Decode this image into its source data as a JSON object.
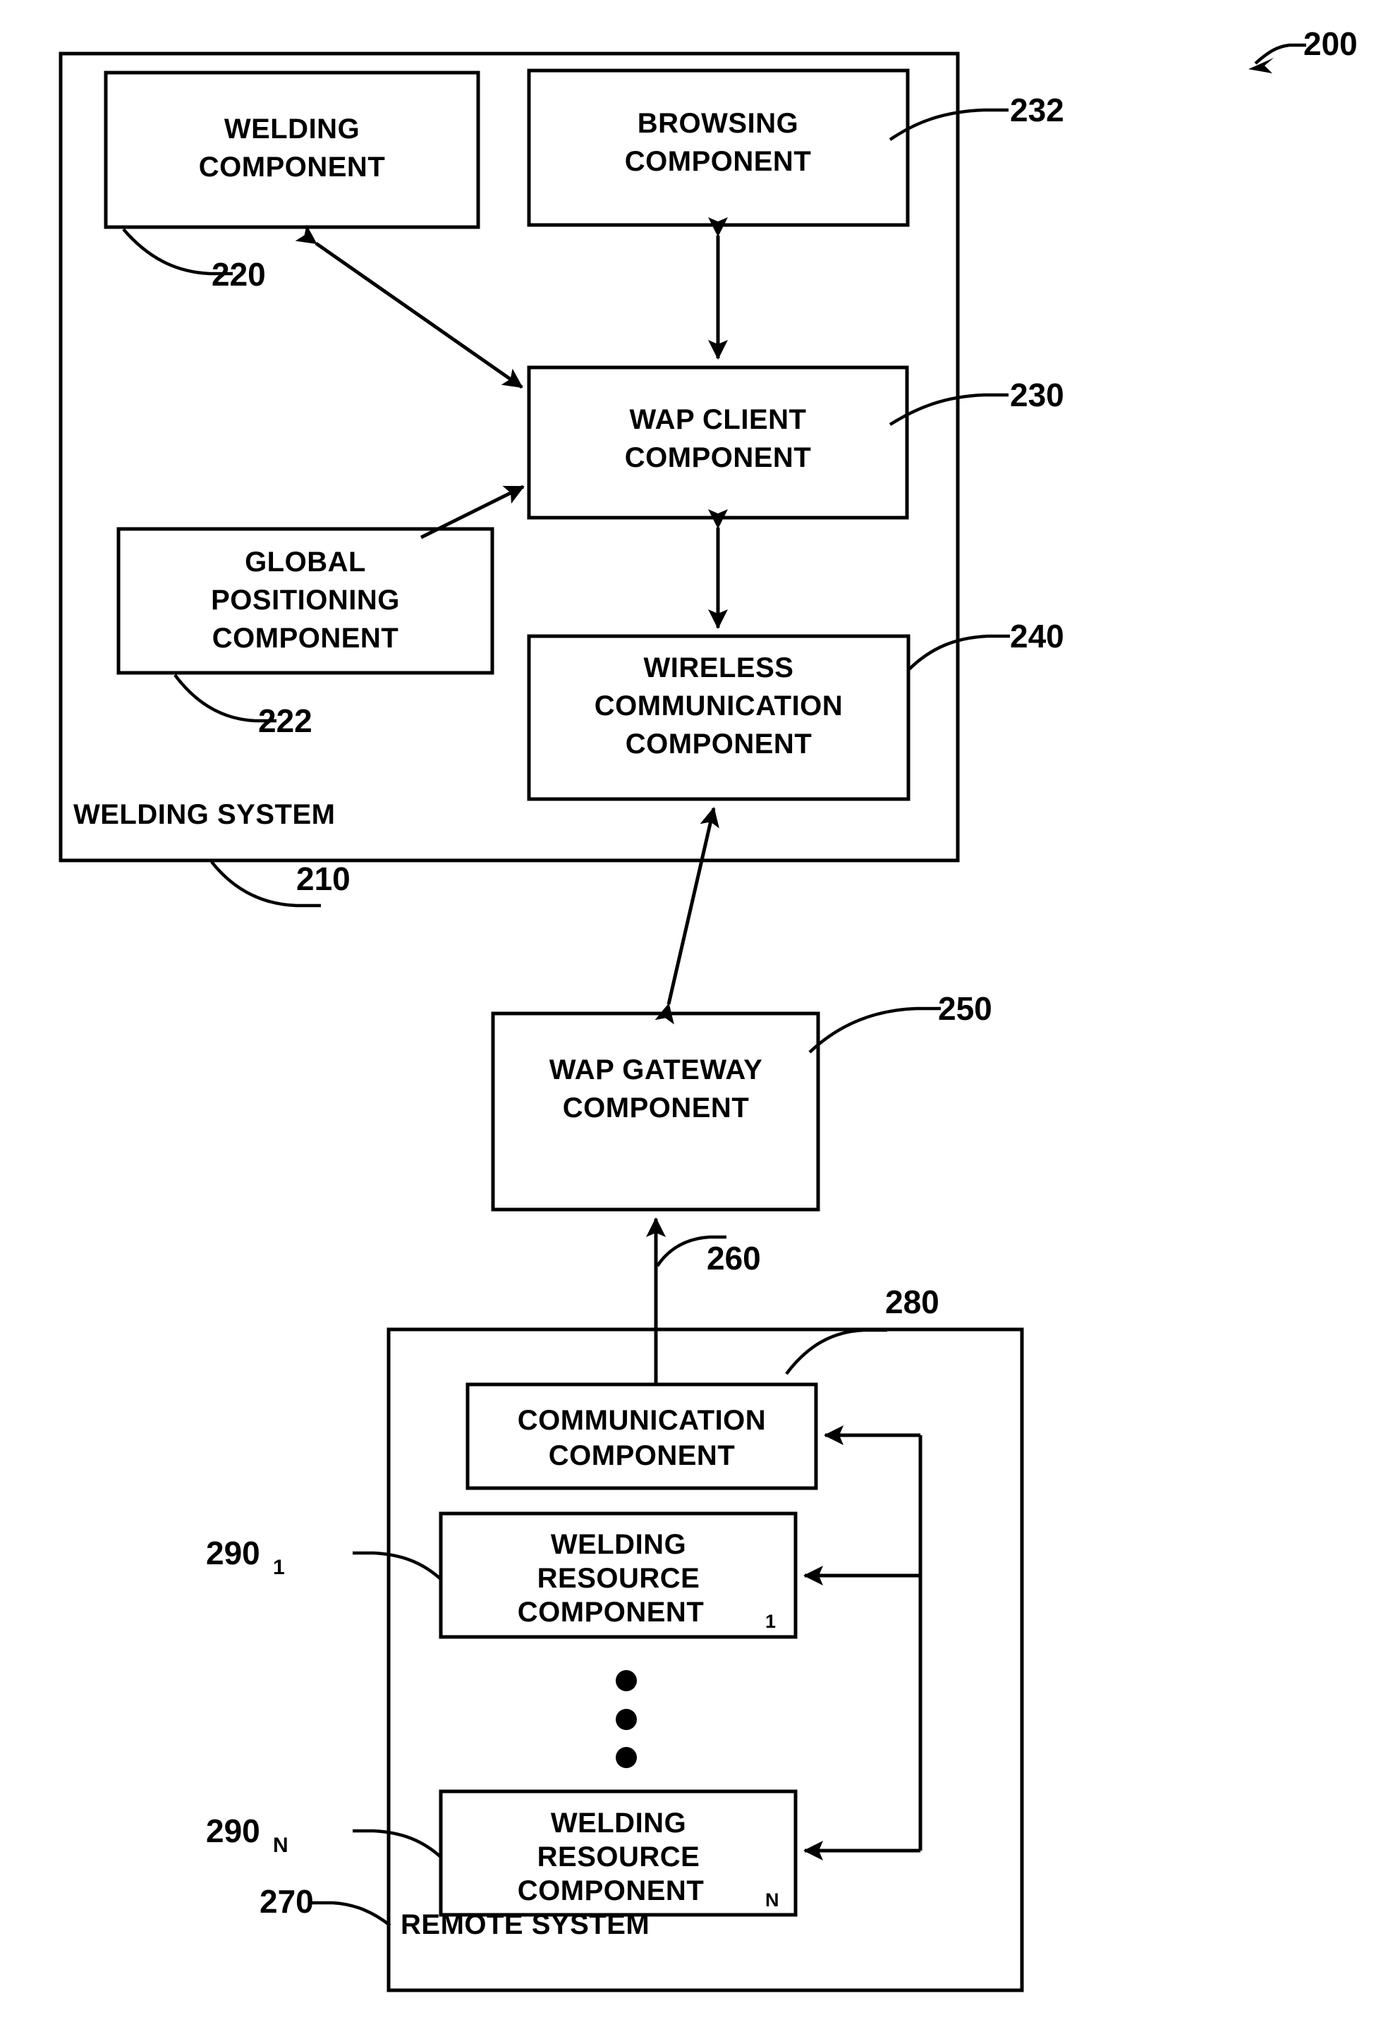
{
  "figure": {
    "figure_reference": "200",
    "systems": [
      {
        "id": "welding-system",
        "label": "WELDING SYSTEM",
        "ref": "210"
      },
      {
        "id": "remote-system",
        "label": "REMOTE SYSTEM",
        "ref": "270"
      }
    ],
    "blocks": [
      {
        "id": "welding-component",
        "lines": [
          "WELDING",
          "COMPONENT"
        ],
        "ref": "220"
      },
      {
        "id": "browsing-component",
        "lines": [
          "BROWSING",
          "COMPONENT"
        ],
        "ref": "232"
      },
      {
        "id": "wap-client-component",
        "lines": [
          "WAP CLIENT",
          "COMPONENT"
        ],
        "ref": "230"
      },
      {
        "id": "global-positioning-component",
        "lines": [
          "GLOBAL",
          "POSITIONING",
          "COMPONENT"
        ],
        "ref": "222"
      },
      {
        "id": "wireless-communication-component",
        "lines": [
          "WIRELESS",
          "COMMUNICATION",
          "COMPONENT"
        ],
        "ref": "240"
      },
      {
        "id": "wap-gateway-component",
        "lines": [
          "WAP GATEWAY",
          "COMPONENT"
        ],
        "ref": "250"
      },
      {
        "id": "communication-component",
        "lines": [
          "COMMUNICATION",
          "COMPONENT"
        ],
        "ref": "280"
      },
      {
        "id": "welding-resource-component-1",
        "lines": [
          "WELDING",
          "RESOURCE",
          "COMPONENT"
        ],
        "subscript": "1",
        "ref": "290",
        "ref_subscript": "1"
      },
      {
        "id": "welding-resource-component-n",
        "lines": [
          "WELDING",
          "RESOURCE",
          "COMPONENT"
        ],
        "subscript": "N",
        "ref": "290",
        "ref_subscript": "N"
      }
    ],
    "link_refs": [
      {
        "id": "wireless-link",
        "ref": "260"
      }
    ],
    "text": {
      "welding_l1": "WELDING",
      "welding_l2": "COMPONENT",
      "browsing_l1": "BROWSING",
      "browsing_l2": "COMPONENT",
      "wapclient_l1": "WAP CLIENT",
      "wapclient_l2": "COMPONENT",
      "gps_l1": "GLOBAL",
      "gps_l2": "POSITIONING",
      "gps_l3": "COMPONENT",
      "wireless_l1": "WIRELESS",
      "wireless_l2": "COMMUNICATION",
      "wireless_l3": "COMPONENT",
      "gateway_l1": "WAP GATEWAY",
      "gateway_l2": "COMPONENT",
      "comm_l1": "COMMUNICATION",
      "comm_l2": "COMPONENT",
      "wrc1_l1": "WELDING",
      "wrc1_l2": "RESOURCE",
      "wrc1_l3": "COMPONENT",
      "wrc1_sub": "1",
      "wrcn_l1": "WELDING",
      "wrcn_l2": "RESOURCE",
      "wrcn_l3": "COMPONENT",
      "wrcn_sub": "N",
      "welding_system": "WELDING SYSTEM",
      "remote_system": "REMOTE SYSTEM",
      "ref_200": "200",
      "ref_210": "210",
      "ref_220": "220",
      "ref_222": "222",
      "ref_230": "230",
      "ref_232": "232",
      "ref_240": "240",
      "ref_250": "250",
      "ref_260": "260",
      "ref_270": "270",
      "ref_280": "280",
      "ref_290a": "290",
      "ref_290a_sub": "1",
      "ref_290b": "290",
      "ref_290b_sub": "N"
    },
    "colors": {
      "ink": "#000000",
      "paper": "#ffffff"
    }
  }
}
